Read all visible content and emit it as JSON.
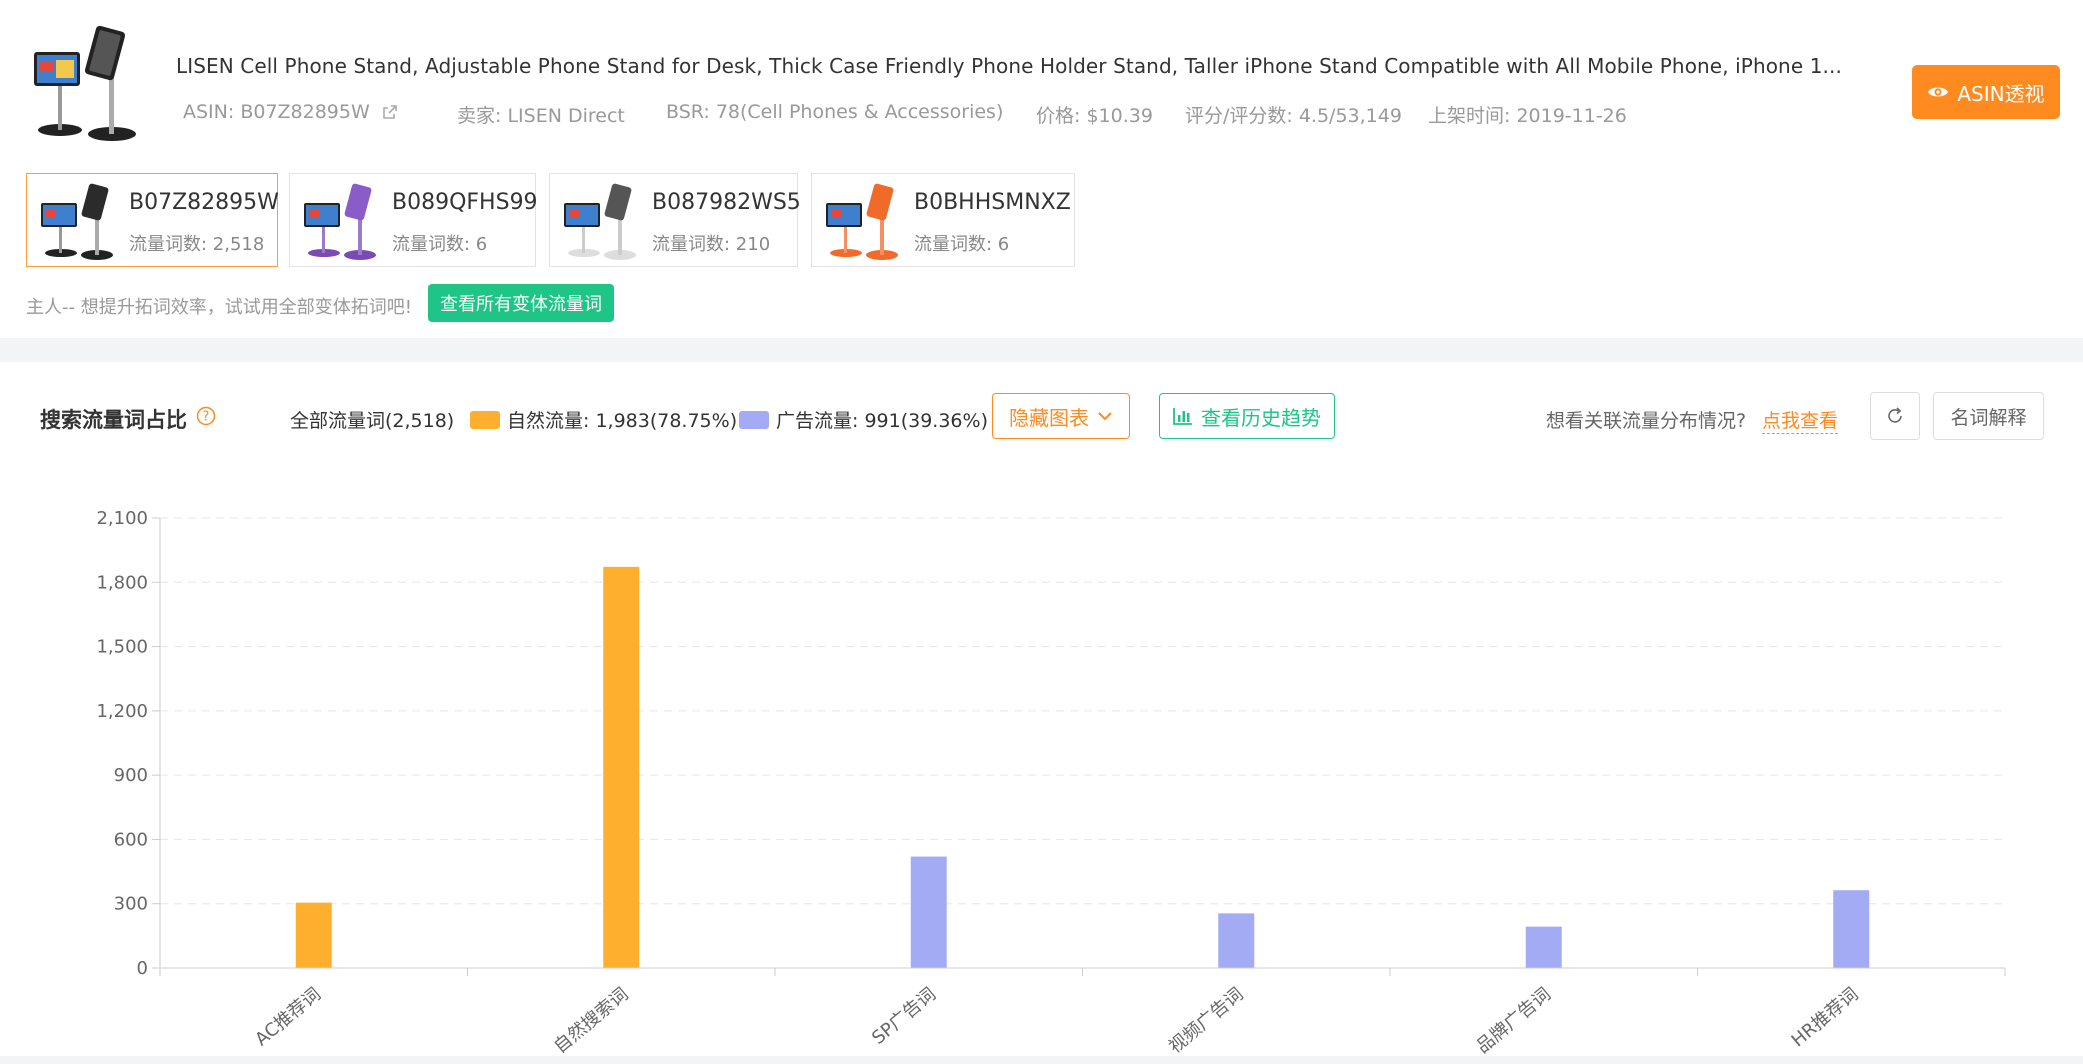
{
  "product": {
    "title": "LISEN Cell Phone Stand, Adjustable Phone Stand for Desk, Thick Case Friendly Phone Holder Stand, Taller iPhone Stand Compatible with All Mobile Phone, iPhone 1...",
    "asin": "ASIN: B07Z82895W",
    "seller": "卖家: LISEN Direct",
    "bsr": "BSR: 78(Cell Phones & Accessories)",
    "price": "价格: $10.39",
    "rating": "评分/评分数: 4.5/53,149",
    "listed": "上架时间: 2019-11-26",
    "asin_button": "ASIN透视"
  },
  "variants": [
    {
      "asin": "B07Z82895W",
      "count": "流量词数: 2,518",
      "color": "#2b2b2b"
    },
    {
      "asin": "B089QFHS99",
      "count": "流量词数: 6",
      "color": "#7b4bb3"
    },
    {
      "asin": "B087982WS5",
      "count": "流量词数: 210",
      "color": "#e8e8e8"
    },
    {
      "asin": "B0BHHSMNXZ",
      "count": "流量词数: 6",
      "color": "#f06a2a"
    }
  ],
  "hint": {
    "text": "主人-- 想提升拓词效率，试试用全部变体拓词吧!",
    "button": "查看所有变体流量词"
  },
  "stats": {
    "title": "搜索流量词占比",
    "all": "全部流量词(2,518)",
    "organic": "自然流量: 1,983(78.75%)",
    "ads": "广告流量: 991(39.36%)",
    "hide_chart": "隐藏图表",
    "history": "查看历史趋势",
    "related_q": "想看关联流量分布情况?",
    "related_link": "点我查看",
    "glossary": "名词解释"
  },
  "colors": {
    "accent": "#ff8a1f",
    "green": "#1fc587",
    "organic": "#ffaf2e",
    "ads": "#a3abf5"
  },
  "chart_data": {
    "type": "bar",
    "categories": [
      "AC推荐词",
      "自然搜索词",
      "SP广告词",
      "视频广告词",
      "品牌广告词",
      "HR推荐词"
    ],
    "values": [
      305,
      1872,
      520,
      255,
      193,
      363
    ],
    "bar_colors": [
      "#ffaf2e",
      "#ffaf2e",
      "#a3abf5",
      "#a3abf5",
      "#a3abf5",
      "#a3abf5"
    ],
    "yticks": [
      "0",
      "300",
      "600",
      "900",
      "1,200",
      "1,500",
      "1,800",
      "2,100"
    ],
    "ylim": [
      0,
      2100
    ],
    "grid": true
  }
}
